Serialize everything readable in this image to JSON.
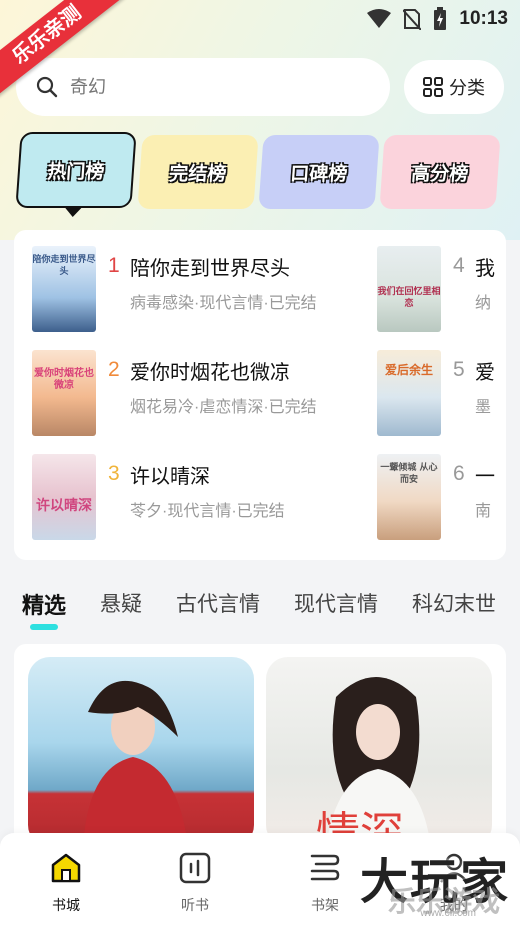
{
  "badge": "乐乐亲测",
  "status": {
    "time": "10:13"
  },
  "search": {
    "placeholder": "奇幻",
    "category_label": "分类"
  },
  "rank_tabs": [
    {
      "label": "热门榜",
      "active": true,
      "color": "#bfeaf0"
    },
    {
      "label": "完结榜",
      "active": false,
      "color": "#fbefb3"
    },
    {
      "label": "口碑榜",
      "active": false,
      "color": "#c7cff7"
    },
    {
      "label": "高分榜",
      "active": false,
      "color": "#fbd3dc"
    }
  ],
  "rankings": [
    {
      "rank": "1",
      "title": "陪你走到世界尽头",
      "meta": "病毒感染·现代言情·已完结",
      "cover_text": "陪你走到世界尽头",
      "rank_color": "#e04545"
    },
    {
      "rank": "2",
      "title": "爱你时烟花也微凉",
      "meta": "烟花易冷·虐恋情深·已完结",
      "cover_text": "爱你时烟花也微凉",
      "rank_color": "#f08a3a"
    },
    {
      "rank": "3",
      "title": "许以晴深",
      "meta": "苓夕·现代言情·已完结",
      "cover_text": "许以晴深",
      "rank_color": "#f0b43a"
    },
    {
      "rank": "4",
      "title": "我",
      "meta": "纳",
      "cover_text": "我们在回忆里相恋",
      "rank_color": "#999999"
    },
    {
      "rank": "5",
      "title": "爱",
      "meta": "墨",
      "cover_text": "爱后余生",
      "rank_color": "#999999"
    },
    {
      "rank": "6",
      "title": "一",
      "meta": "南",
      "cover_text": "一颦倾城 从心而安",
      "rank_color": "#999999"
    }
  ],
  "genres": [
    {
      "label": "精选",
      "active": true
    },
    {
      "label": "悬疑",
      "active": false
    },
    {
      "label": "古代言情",
      "active": false
    },
    {
      "label": "现代言情",
      "active": false
    },
    {
      "label": "科幻末世",
      "active": false
    }
  ],
  "featured": [
    {
      "caption": ""
    },
    {
      "caption": "情深"
    }
  ],
  "nav": [
    {
      "label": "书城",
      "active": true
    },
    {
      "label": "听书",
      "active": false
    },
    {
      "label": "书架",
      "active": false
    },
    {
      "label": "我的",
      "active": false
    }
  ],
  "watermark": {
    "main": "大玩家",
    "sub": "乐乐游戏",
    "url": "www.6ll.com"
  },
  "colors": {
    "accent": "#2ee0e0",
    "badge_red": "#e8303a",
    "nav_active": "#f5d800"
  }
}
